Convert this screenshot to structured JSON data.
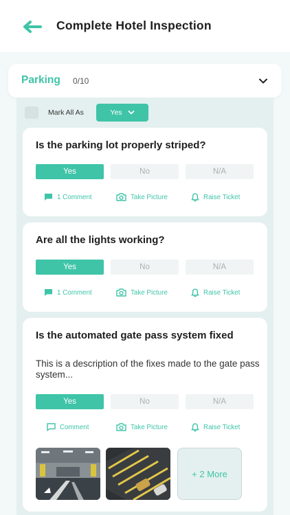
{
  "header": {
    "title": "Complete Hotel Inspection"
  },
  "section": {
    "name": "Parking",
    "count": "0/10"
  },
  "mark_all": {
    "label": "Mark All As",
    "value": "Yes"
  },
  "options": {
    "yes": "Yes",
    "no": "No",
    "na": "N/A"
  },
  "questions": [
    {
      "title": "Is the parking lot properly striped?",
      "comment_label": "1 Comment",
      "picture_label": "Take Picture",
      "ticket_label": "Raise Ticket",
      "selected": "Yes"
    },
    {
      "title": "Are all the lights working?",
      "comment_label": "1 Comment",
      "picture_label": "Take Picture",
      "ticket_label": "Raise Ticket",
      "selected": "Yes"
    },
    {
      "title": "Is the automated gate pass system fixed",
      "description": "This is a description of the fixes made to the gate pass system...",
      "comment_label": "Comment",
      "picture_label": "Take Picture",
      "ticket_label": "Raise Ticket",
      "selected": "Yes",
      "more_photos": "+ 2 More"
    }
  ],
  "colors": {
    "accent": "#3fc4a8",
    "option_off": "#f1f4f4",
    "list_bg": "#e4f0ef"
  }
}
